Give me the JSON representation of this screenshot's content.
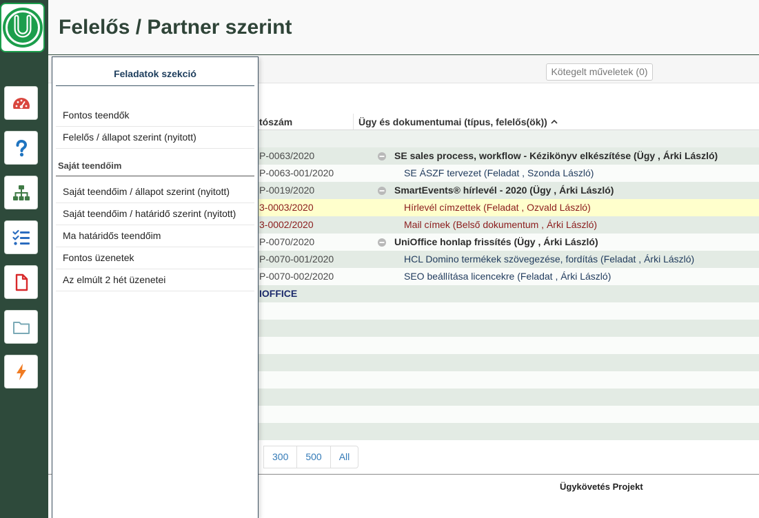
{
  "header": {
    "title": "Felelős / Partner szerint"
  },
  "logo": {
    "icon": "uni-logo-icon",
    "color": "#1c9e4c"
  },
  "sidebar": {
    "items": [
      {
        "icon": "gauge-icon",
        "color": "#d9463e"
      },
      {
        "icon": "question-icon",
        "color": "#1f74c0"
      },
      {
        "icon": "sitemap-icon",
        "color": "#3f7a45"
      },
      {
        "icon": "list-check-icon",
        "color": "#2a6cbf"
      },
      {
        "icon": "file-icon",
        "color": "#d8282a"
      },
      {
        "icon": "folder-icon",
        "color": "#7aa9b6"
      },
      {
        "icon": "bolt-icon",
        "color": "#f07b22"
      }
    ]
  },
  "toolbar": {
    "batch_label": "Kötegelt műveletek (0)"
  },
  "table": {
    "columns": [
      {
        "label": "tószám"
      },
      {
        "label": "Ügy és dokumentumai (típus, felelős(ök))",
        "sort_icon": "chevron-up-icon"
      }
    ],
    "rows": [
      {
        "number": "P-0063/2020",
        "text": "SE sales process, workflow - Kézikönyv elkészítése (Ügy , Árki László)",
        "expanded": true
      },
      {
        "number": "P-0063-001/2020",
        "text": "SE ÁSZF tervezet (Feladat , Szonda László)"
      },
      {
        "number": "P-0019/2020",
        "text": "SmartEvents® hírlevél - 2020 (Ügy , Árki László)",
        "expanded": true
      },
      {
        "number": "3-0003/2020",
        "text": "Hírlevél címzettek (Feladat , Ozvald László)",
        "highlighted": true
      },
      {
        "number": "3-0002/2020",
        "text": "Mail címek (Belső dokumentum , Árki László)"
      },
      {
        "number": "P-0070/2020",
        "text": "UniOffice honlap frissítés (Ügy , Árki László)",
        "expanded": true
      },
      {
        "number": "P-0070-001/2020",
        "text": "HCL Domino termékek szövegezése, fordítás (Feladat , Árki László)"
      },
      {
        "number": "P-0070-002/2020",
        "text": "SEO beállítása licencekre (Feladat , Árki László)"
      },
      {
        "number": "IOFFICE"
      }
    ]
  },
  "pagination": {
    "options": [
      "300",
      "500",
      "All"
    ]
  },
  "footer": {
    "text": "Ügykövetés Projekt"
  },
  "panel": {
    "title": "Feladatok szekció",
    "items": [
      "Fontos teendők",
      "Felelős / állapot szerint (nyitott)"
    ],
    "section": {
      "title": "Saját teendőim",
      "items": [
        "Saját teendőim / állapot szerint (nyitott)",
        "Saját teendőim / határidő szerint (nyitott)",
        "Ma határidős teendőim",
        "Fontos üzenetek",
        "Az elmúlt 2 hét üzenetei"
      ]
    }
  },
  "colors": {
    "sidebar": "#2e4a3b",
    "brand": "#1c9e4c",
    "highlight": "#ffffcc",
    "link": "#337ab7",
    "alert": "#8b1c1c",
    "child": "#1f3a5c",
    "category": "#1b2a6b"
  }
}
